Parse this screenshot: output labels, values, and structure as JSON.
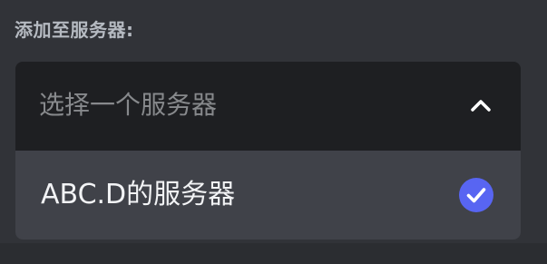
{
  "field": {
    "label": "添加至服务器:"
  },
  "select": {
    "placeholder": "选择一个服务器",
    "expanded": true,
    "chevron_icon": "chevron-up-icon",
    "options": [
      {
        "label": "ABC.D的服务器",
        "selected": true,
        "check_icon": "check-circle-icon"
      }
    ]
  },
  "colors": {
    "background": "#313338",
    "input_background": "#1e1f22",
    "option_selected_background": "#404249",
    "accent": "#5865f2",
    "label_text": "#b5bac1",
    "placeholder_text": "#87898c",
    "option_text": "#f2f3f5"
  }
}
